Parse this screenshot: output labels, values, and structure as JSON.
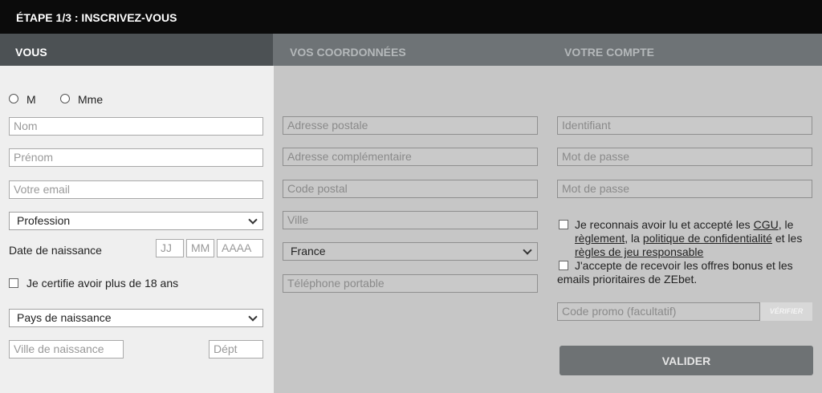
{
  "header": {
    "step_title": "ÉTAPE 1/3 : INSCRIVEZ-VOUS"
  },
  "tabs": [
    {
      "label": "VOUS",
      "active": true
    },
    {
      "label": "VOS COORDONNÉES",
      "active": false
    },
    {
      "label": "VOTRE COMPTE",
      "active": false
    }
  ],
  "vous": {
    "civility": {
      "m_label": "M",
      "mme_label": "Mme"
    },
    "nom_placeholder": "Nom",
    "prenom_placeholder": "Prénom",
    "email_placeholder": "Votre email",
    "profession_value": "Profession",
    "birthdate_label": "Date de naissance",
    "birthdate_day": "JJ",
    "birthdate_month": "MM",
    "birthdate_year": "AAAA",
    "age_certify_label": "Je certifie avoir plus de 18 ans",
    "birth_country_value": "Pays de naissance",
    "birth_city_placeholder": "Ville de naissance",
    "dept_placeholder": "Dépt"
  },
  "coordonnees": {
    "address_placeholder": "Adresse postale",
    "address2_placeholder": "Adresse complémentaire",
    "postal_code_placeholder": "Code postal",
    "city_placeholder": "Ville",
    "country_value": "France",
    "mobile_placeholder": "Téléphone portable"
  },
  "compte": {
    "username_placeholder": "Identifiant",
    "password_placeholder": "Mot de passe",
    "password_confirm_placeholder": "Mot de passe",
    "terms": {
      "t1": "Je reconnais avoir lu et accepté les ",
      "cgu": "CGU",
      "t2": ", le ",
      "reglement": "règlement",
      "t3": ", la ",
      "privacy": "politique de confidentialité",
      "t4": " et les ",
      "responsible": "règles de jeu responsable"
    },
    "offers_label": "J'accepte de recevoir les offres bonus et les emails prioritaires de ZEbet.",
    "promo_placeholder": "Code promo (facultatif)",
    "verify_label": "VÉRIFIER",
    "submit_label": "VALIDER"
  }
}
